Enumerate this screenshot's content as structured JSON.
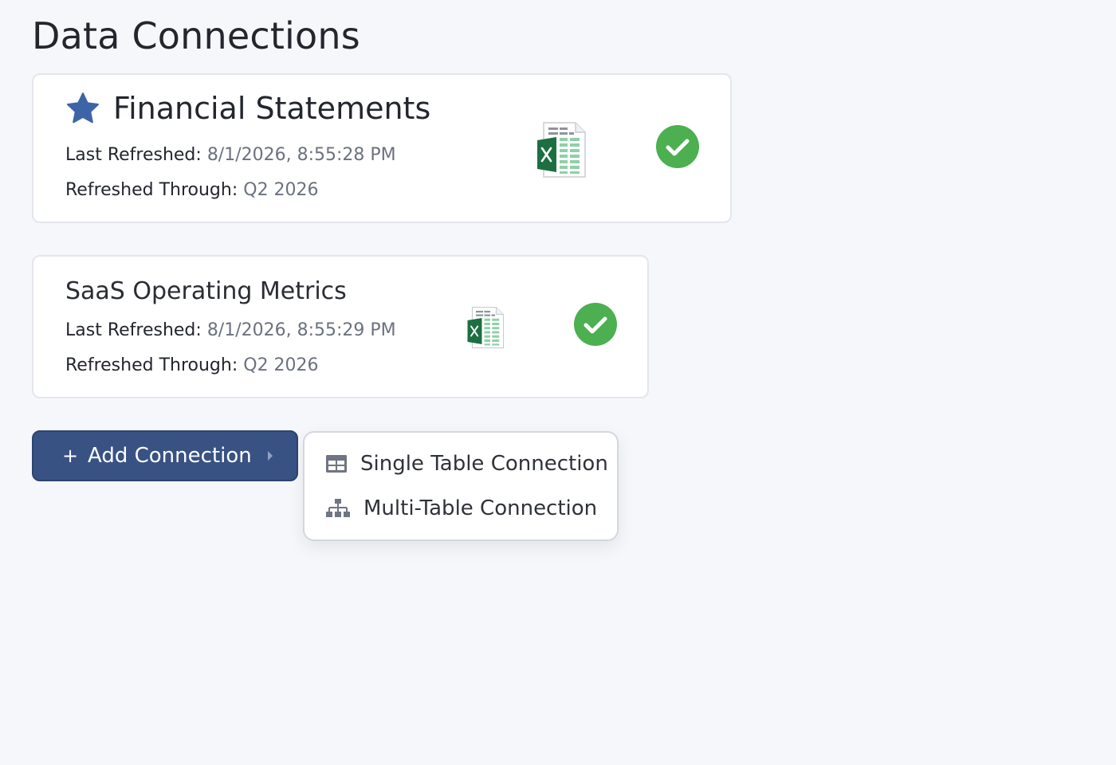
{
  "page": {
    "title": "Data Connections"
  },
  "colors": {
    "background": "#f6f7fb",
    "card_bg": "#ffffff",
    "star": "#3e64a8",
    "success": "#4caf50",
    "primary_button": "#385283",
    "excel_green": "#1d6f42"
  },
  "connections": [
    {
      "name": "Financial Statements",
      "favorite": true,
      "last_refreshed_label": "Last Refreshed:",
      "last_refreshed_value": "8/1/2026, 8:55:28 PM",
      "refreshed_through_label": "Refreshed Through:",
      "refreshed_through_value": "Q2 2026",
      "file_icon": "excel-file-icon",
      "status_icon": "check-circle-icon"
    },
    {
      "name": "SaaS Operating Metrics",
      "favorite": false,
      "last_refreshed_label": "Last Refreshed:",
      "last_refreshed_value": "8/1/2026, 8:55:29 PM",
      "refreshed_through_label": "Refreshed Through:",
      "refreshed_through_value": "Q2 2026",
      "file_icon": "excel-file-icon",
      "status_icon": "check-circle-icon"
    }
  ],
  "add_button": {
    "plus": "+",
    "label": "Add Connection",
    "icon": "chevron-right-icon"
  },
  "dropdown": {
    "items": [
      {
        "label": "Single Table Connection",
        "icon": "table-icon"
      },
      {
        "label": "Multi-Table Connection",
        "icon": "hierarchy-icon"
      }
    ]
  }
}
